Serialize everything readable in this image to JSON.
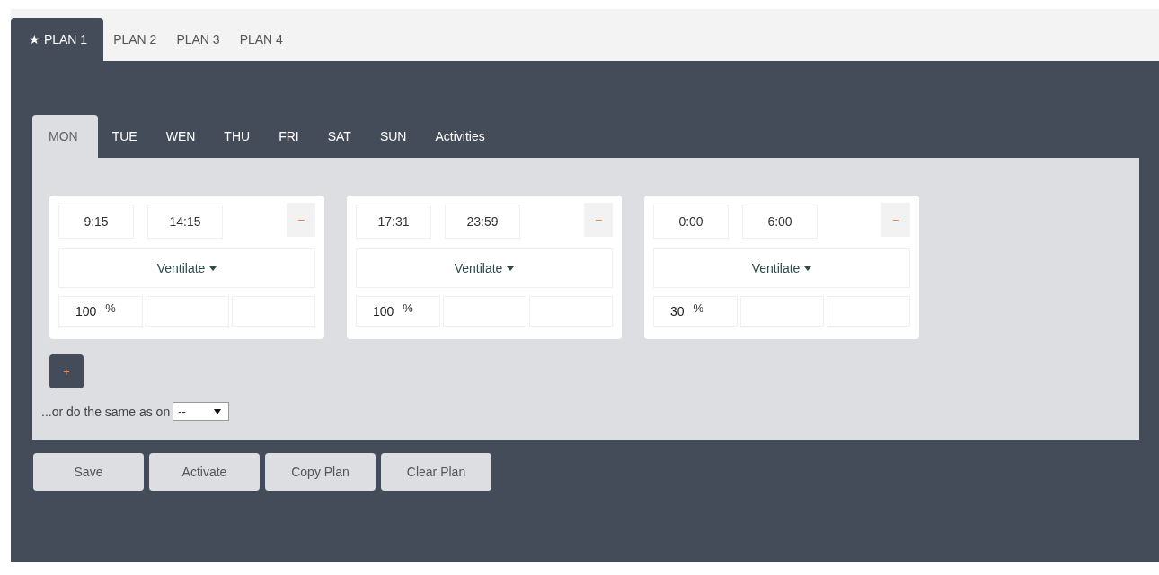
{
  "plan_tabs": [
    {
      "label": "★ PLAN 1",
      "selected": true
    },
    {
      "label": "PLAN 2",
      "selected": false
    },
    {
      "label": "PLAN 3",
      "selected": false
    },
    {
      "label": "PLAN 4",
      "selected": false
    }
  ],
  "day_tabs": [
    {
      "label": "MON",
      "selected": true
    },
    {
      "label": "TUE",
      "selected": false
    },
    {
      "label": "WEN",
      "selected": false
    },
    {
      "label": "THU",
      "selected": false
    },
    {
      "label": "FRI",
      "selected": false
    },
    {
      "label": "SAT",
      "selected": false
    },
    {
      "label": "SUN",
      "selected": false
    },
    {
      "label": "Activities",
      "selected": false
    }
  ],
  "slots": [
    {
      "start": "9:15",
      "end": "14:15",
      "remove": "−",
      "action": "Ventilate",
      "value": "100",
      "unit": "%"
    },
    {
      "start": "17:31",
      "end": "23:59",
      "remove": "−",
      "action": "Ventilate",
      "value": "100",
      "unit": "%"
    },
    {
      "start": "0:00",
      "end": "6:00",
      "remove": "−",
      "action": "Ventilate",
      "value": "30",
      "unit": "%"
    }
  ],
  "add_button": "+",
  "same_as": {
    "label": "...or do the same as on",
    "value": "--"
  },
  "buttons": [
    "Save",
    "Activate",
    "Copy Plan",
    "Clear Plan"
  ]
}
